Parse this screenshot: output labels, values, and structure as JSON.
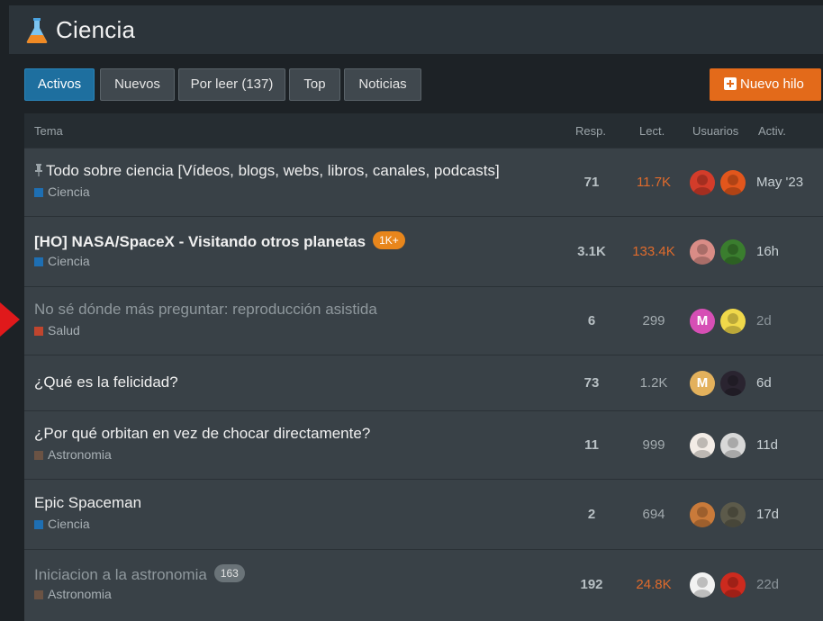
{
  "header": {
    "title": "Ciencia",
    "icon": "flask-icon"
  },
  "nav": {
    "tabs": [
      {
        "label": "Activos",
        "active": true
      },
      {
        "label": "Nuevos",
        "active": false
      },
      {
        "label": "Por leer (137)",
        "active": false
      },
      {
        "label": "Top",
        "active": false
      },
      {
        "label": "Noticias",
        "active": false
      }
    ],
    "new_topic": "Nuevo hilo"
  },
  "table": {
    "headers": {
      "topic": "Tema",
      "replies": "Resp.",
      "views": "Lect.",
      "users": "Usuarios",
      "activity": "Activ."
    },
    "rows": [
      {
        "title": "Todo sobre ciencia [Vídeos, blogs, webs, libros, canales, podcasts]",
        "pinned": true,
        "bold": false,
        "read": false,
        "badge": "",
        "category": "Ciencia",
        "category_color": "#1e6fb3",
        "replies": "71",
        "views": "11.7K",
        "views_hot": true,
        "activity": "May '23"
      },
      {
        "title": "[HO] NASA/SpaceX - Visitando otros planetas",
        "pinned": false,
        "bold": true,
        "read": false,
        "badge": "1K+",
        "category": "Ciencia",
        "category_color": "#1e6fb3",
        "replies": "3.1K",
        "views": "133.4K",
        "views_hot": true,
        "activity": "16h"
      },
      {
        "title": "No sé dónde más preguntar: reproducción asistida",
        "pinned": false,
        "bold": false,
        "read": true,
        "badge": "",
        "category": "Salud",
        "category_color": "#c0452e",
        "replies": "6",
        "views": "299",
        "views_hot": false,
        "activity": "2d"
      },
      {
        "title": "¿Qué es la felicidad?",
        "pinned": false,
        "bold": false,
        "read": false,
        "badge": "",
        "category": "",
        "category_color": "",
        "replies": "73",
        "views": "1.2K",
        "views_hot": false,
        "activity": "6d"
      },
      {
        "title": "¿Por qué orbitan en vez de chocar directamente?",
        "pinned": false,
        "bold": false,
        "read": false,
        "badge": "",
        "category": "Astronomia",
        "category_color": "#6b5344",
        "replies": "11",
        "views": "999",
        "views_hot": false,
        "activity": "11d"
      },
      {
        "title": "Epic Spaceman",
        "pinned": false,
        "bold": false,
        "read": false,
        "badge": "",
        "category": "Ciencia",
        "category_color": "#1e6fb3",
        "replies": "2",
        "views": "694",
        "views_hot": false,
        "activity": "17d"
      },
      {
        "title": "Iniciacion a la astronomia",
        "pinned": false,
        "bold": false,
        "read": true,
        "badge": "163",
        "category": "Astronomia",
        "category_color": "#6b5344",
        "replies": "192",
        "views": "24.8K",
        "views_hot": true,
        "activity": "22d"
      }
    ],
    "avatars": [
      [
        "#d33c2a",
        "#e2561c"
      ],
      [
        "#d98c86",
        "#3a7d2e"
      ],
      [
        "#d64fb5",
        "#f0d84a"
      ],
      [
        "#e3b15c",
        "#2a2430"
      ],
      [
        "#f3ece6",
        "#d8d8d8"
      ],
      [
        "#c97a3a",
        "#5c5a4a"
      ],
      [
        "#f2f2f2",
        "#cc2a1e"
      ]
    ],
    "avatar_letters": [
      [
        "",
        ""
      ],
      [
        "",
        ""
      ],
      [
        "M",
        ""
      ],
      [
        "M",
        ""
      ],
      [
        "",
        ""
      ],
      [
        "",
        ""
      ],
      [
        "",
        ""
      ]
    ]
  }
}
